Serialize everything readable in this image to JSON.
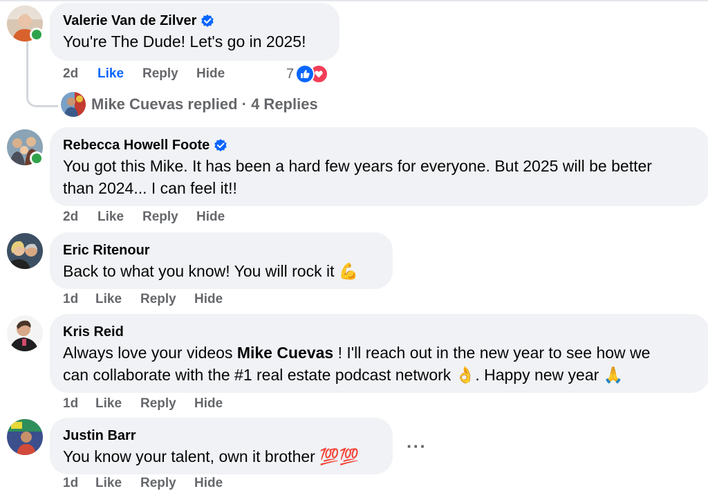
{
  "comments": [
    {
      "author": "Valerie Van de Zilver",
      "verified": true,
      "text": "You're The Dude! Let's go in 2025!",
      "time": "2d",
      "like": "Like",
      "reply": "Reply",
      "hide": "Hide",
      "reaction_count": "7"
    },
    {
      "author": "Rebecca Howell Foote",
      "verified": true,
      "text_line1": "You got this Mike. It has been a hard few years for everyone. But 2025 will be better",
      "text_line2": "than 2024... I can feel it!!",
      "time": "2d",
      "like": "Like",
      "reply": "Reply",
      "hide": "Hide"
    },
    {
      "author": "Eric Ritenour",
      "text": "Back to what you know! You will rock it",
      "emoji": "💪",
      "time": "1d",
      "like": "Like",
      "reply": "Reply",
      "hide": "Hide"
    },
    {
      "author": "Kris Reid",
      "text_pre": "Always love your videos ",
      "mention": "Mike Cuevas",
      "text_post": " ! I'll reach out in the new year to see how we",
      "text_line2": "can collaborate with the #1 real estate podcast network",
      "emoji1": "👌",
      "text_line2_post": ". Happy new year",
      "emoji2": "🙏",
      "time": "1d",
      "like": "Like",
      "reply": "Reply",
      "hide": "Hide"
    },
    {
      "author": "Justin Barr",
      "text": "You know your talent, own it brother",
      "emoji": "💯💯",
      "time": "1d",
      "like": "Like",
      "reply": "Reply",
      "hide": "Hide"
    }
  ],
  "replies": {
    "text": "Mike Cuevas replied · 4 Replies"
  },
  "more_options": "···",
  "colors": {
    "bubble": "#f0f2f5",
    "meta_text": "#65676b",
    "like_active": "#0866ff",
    "verified": "#0866ff",
    "online": "#31a24c",
    "love": "#f33e58"
  },
  "icons": [
    "verified-badge-icon",
    "like-reaction-icon",
    "love-reaction-icon",
    "online-status-icon",
    "more-options-icon"
  ]
}
